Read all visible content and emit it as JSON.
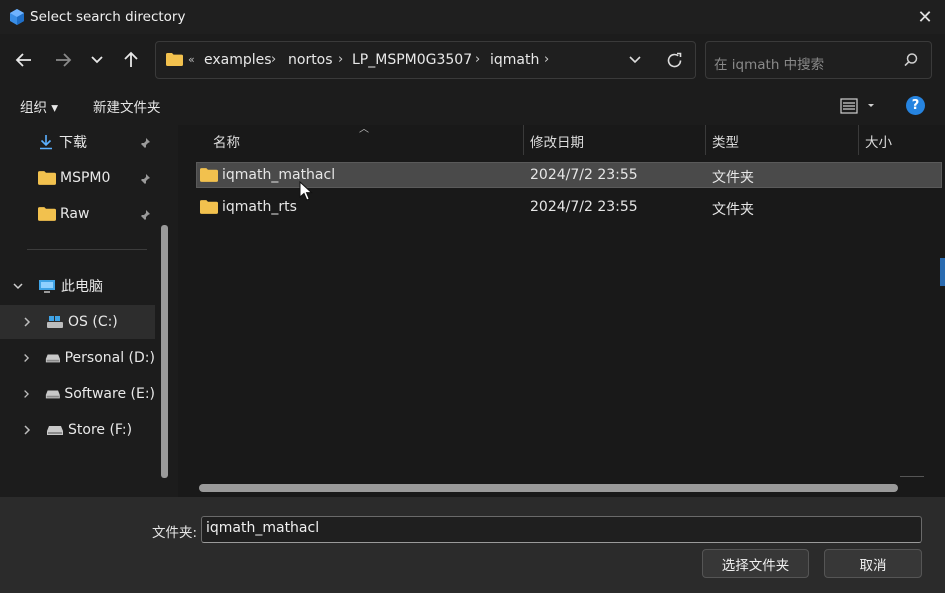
{
  "window": {
    "title": "Select search directory",
    "close_label": "✕"
  },
  "address_bar": {
    "overflow": "«",
    "crumbs": [
      "examples",
      "nortos",
      "LP_MSPM0G3507",
      "iqmath"
    ],
    "separator": "›"
  },
  "search": {
    "placeholder": "在 iqmath 中搜索"
  },
  "toolbar": {
    "organize_label": "组织 ▾",
    "new_folder_label": "新建文件夹"
  },
  "help": {
    "label": "?"
  },
  "nav_pane": {
    "quick_access": [
      {
        "label": "下载",
        "icon": "download-icon"
      },
      {
        "label": "MSPM0",
        "icon": "folder-icon"
      },
      {
        "label": "Raw",
        "icon": "folder-icon"
      }
    ],
    "this_pc": {
      "label": "此电脑",
      "icon": "computer-icon"
    },
    "drives": [
      {
        "label": "OS (C:)",
        "icon": "os-drive-icon"
      },
      {
        "label": "Personal (D:)",
        "icon": "drive-icon"
      },
      {
        "label": "Software (E:)",
        "icon": "drive-icon"
      },
      {
        "label": "Store (F:)",
        "icon": "drive-icon"
      }
    ]
  },
  "file_list": {
    "columns": [
      "名称",
      "修改日期",
      "类型",
      "大小"
    ],
    "rows": [
      {
        "name": "iqmath_mathacl",
        "modified": "2024/7/2 23:55",
        "type": "文件夹",
        "size": ""
      },
      {
        "name": "iqmath_rts",
        "modified": "2024/7/2 23:55",
        "type": "文件夹",
        "size": ""
      }
    ]
  },
  "footer": {
    "filename_label": "文件夹:",
    "filename_value": "iqmath_mathacl",
    "select_button": "选择文件夹",
    "cancel_button": "取消"
  },
  "colors": {
    "accent": "#2684e0",
    "folder": "#f2c14e",
    "selection": "#4a4a4a"
  }
}
